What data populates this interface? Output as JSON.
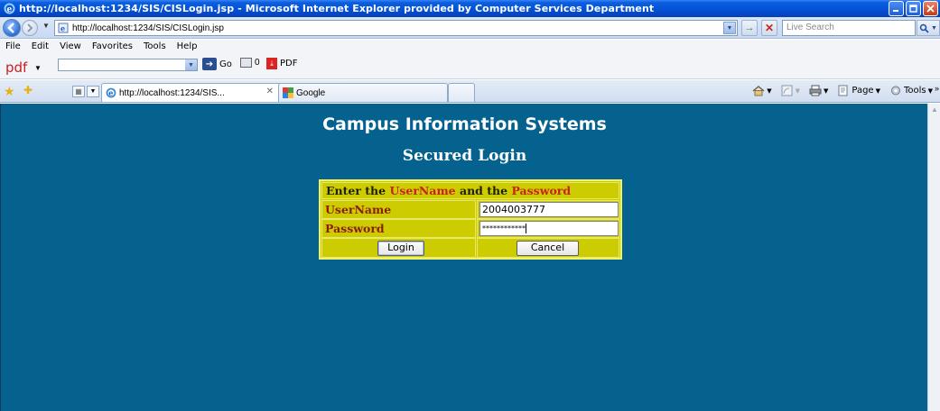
{
  "window": {
    "title": "http://localhost:1234/SIS/CISLogin.jsp - Microsoft Internet Explorer provided by Computer Services Department"
  },
  "address_bar": {
    "url": "http://localhost:1234/SIS/CISLogin.jsp",
    "search_placeholder": "Live Search"
  },
  "menu": {
    "items": [
      "File",
      "Edit",
      "View",
      "Favorites",
      "Tools",
      "Help"
    ]
  },
  "pdf_toolbar": {
    "logo": "pdf",
    "go_label": "Go",
    "count": "0",
    "pdf_label": "PDF"
  },
  "tabs": [
    {
      "label": "http://localhost:1234/SIS...",
      "active": true
    },
    {
      "label": "Google",
      "active": false
    }
  ],
  "command_bar": {
    "page_label": "Page",
    "tools_label": "Tools"
  },
  "page": {
    "title": "Campus Information Systems",
    "subtitle": "Secured Login",
    "form": {
      "header_prefix": "Enter the ",
      "header_user": "UserName",
      "header_mid": " and the ",
      "header_pass": "Password",
      "username_label": "UserName",
      "username_value": "2004003777",
      "password_label": "Password",
      "password_value": "************",
      "login_button": "Login",
      "cancel_button": "Cancel"
    },
    "background_color": "#05628f",
    "form_color": "#cccc00"
  },
  "icons": [
    "ie-icon",
    "minimize-icon",
    "maximize-icon",
    "close-icon",
    "back-icon",
    "forward-icon",
    "page-icon",
    "go-icon",
    "stop-icon",
    "search-icon",
    "star-icon",
    "add-favorite-icon",
    "quick-tabs-icon",
    "home-icon",
    "feeds-icon",
    "print-icon"
  ]
}
